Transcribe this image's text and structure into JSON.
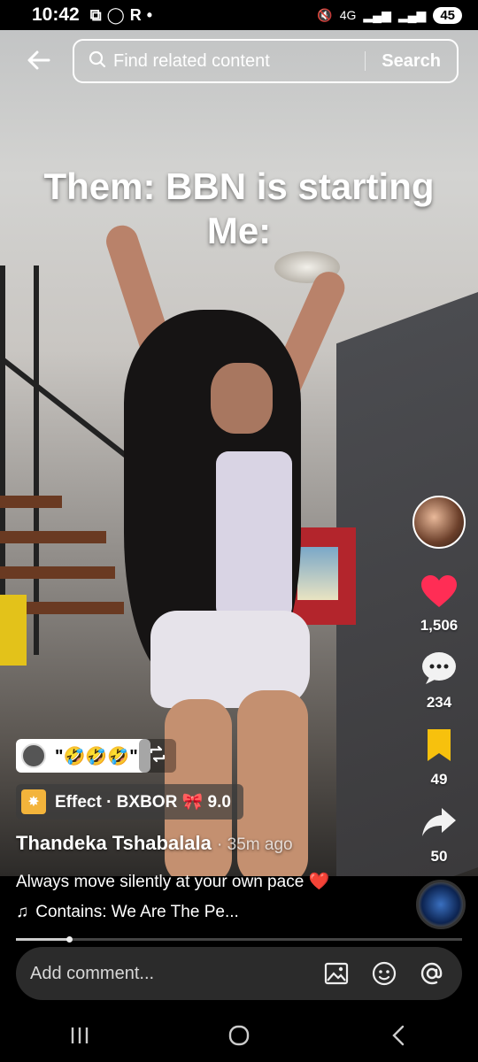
{
  "status_bar": {
    "time": "10:42",
    "battery": "45",
    "network": "4G"
  },
  "header": {
    "search_placeholder": "Find related content",
    "search_button": "Search"
  },
  "video": {
    "caption_line1": "Them: BBN is starting",
    "caption_line2": "Me:"
  },
  "actions": {
    "likes": "1,506",
    "comments": "234",
    "saves": "49",
    "shares": "50",
    "like_color": "#ff2d55",
    "save_color": "#f7c10d"
  },
  "overlays": {
    "emoji_pill": "\"🤣🤣🤣\"",
    "effect_label": "Effect · BXBOR 🎀 9.0"
  },
  "post": {
    "author": "Thandeka Tshabalala",
    "time_ago": "· 35m ago",
    "description": "Always move silently at your own pace ❤️",
    "music": "Contains: We Are The Pe..."
  },
  "progress": 0.12,
  "comment_bar": {
    "placeholder": "Add comment..."
  }
}
